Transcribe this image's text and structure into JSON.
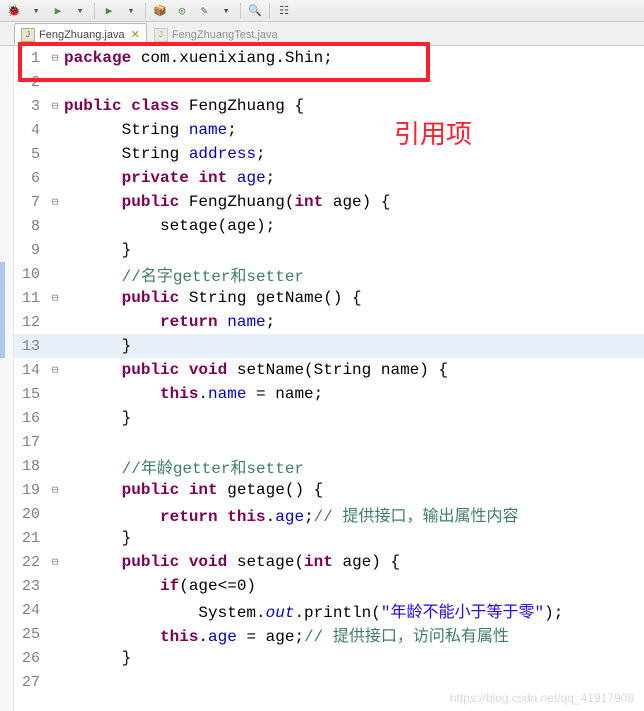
{
  "toolbar": {
    "icons": [
      "debug-icon",
      "dropdown-icon",
      "run-icon",
      "dropdown-icon",
      "sep",
      "run-ext-icon",
      "dropdown-icon",
      "sep",
      "pkg-icon",
      "doc-icon",
      "wand-icon",
      "dropdown-icon",
      "sep",
      "search-icon",
      "sep",
      "nav-icon"
    ]
  },
  "tabs": [
    {
      "label": "FengZhuang.java",
      "active": true
    },
    {
      "label": "FengZhuangTest.java",
      "active": false
    }
  ],
  "annotation": "引用项",
  "watermark": "https://blog.csdn.net/qq_41917908",
  "code_palette": {
    "keyword": "#7f0055",
    "field": "#0000c0",
    "comment": "#3f7f5f",
    "string": "#2a00ff"
  },
  "code": {
    "lines": [
      {
        "n": 1,
        "fold": "-",
        "hi": false,
        "tokens": [
          [
            "kw",
            "package"
          ],
          [
            "",
            " com.xuenixiang.Shin;"
          ]
        ]
      },
      {
        "n": 2,
        "fold": "",
        "hi": false,
        "tokens": []
      },
      {
        "n": 3,
        "fold": "-",
        "hi": false,
        "tokens": [
          [
            "kw",
            "public"
          ],
          [
            "",
            " "
          ],
          [
            "kw",
            "class"
          ],
          [
            "",
            " FengZhuang {"
          ]
        ]
      },
      {
        "n": 4,
        "fold": "",
        "hi": false,
        "tokens": [
          [
            "",
            "      String "
          ],
          [
            "fld",
            "name"
          ],
          [
            "",
            ";"
          ]
        ]
      },
      {
        "n": 5,
        "fold": "",
        "hi": false,
        "tokens": [
          [
            "",
            "      String "
          ],
          [
            "fld",
            "address"
          ],
          [
            "",
            ";"
          ]
        ]
      },
      {
        "n": 6,
        "fold": "",
        "hi": false,
        "tokens": [
          [
            "",
            "      "
          ],
          [
            "kw",
            "private"
          ],
          [
            "",
            " "
          ],
          [
            "kw",
            "int"
          ],
          [
            "",
            " "
          ],
          [
            "fld",
            "age"
          ],
          [
            "",
            ";"
          ]
        ]
      },
      {
        "n": 7,
        "fold": "-",
        "hi": false,
        "tokens": [
          [
            "",
            "      "
          ],
          [
            "kw",
            "public"
          ],
          [
            "",
            " FengZhuang("
          ],
          [
            "kw",
            "int"
          ],
          [
            "",
            " age) {"
          ]
        ]
      },
      {
        "n": 8,
        "fold": "",
        "hi": false,
        "tokens": [
          [
            "",
            "          setage(age);"
          ]
        ]
      },
      {
        "n": 9,
        "fold": "",
        "hi": false,
        "tokens": [
          [
            "",
            "      }"
          ]
        ]
      },
      {
        "n": 10,
        "fold": "",
        "hi": false,
        "tokens": [
          [
            "",
            "      "
          ],
          [
            "cm",
            "//名字getter和setter"
          ]
        ]
      },
      {
        "n": 11,
        "fold": "-",
        "hi": false,
        "tokens": [
          [
            "",
            "      "
          ],
          [
            "kw",
            "public"
          ],
          [
            "",
            " String getName() {"
          ]
        ]
      },
      {
        "n": 12,
        "fold": "",
        "hi": false,
        "tokens": [
          [
            "",
            "          "
          ],
          [
            "kw",
            "return"
          ],
          [
            "",
            " "
          ],
          [
            "fld",
            "name"
          ],
          [
            "",
            ";"
          ]
        ]
      },
      {
        "n": 13,
        "fold": "",
        "hi": true,
        "tokens": [
          [
            "",
            "      }"
          ]
        ]
      },
      {
        "n": 14,
        "fold": "-",
        "hi": false,
        "tokens": [
          [
            "",
            "      "
          ],
          [
            "kw",
            "public"
          ],
          [
            "",
            " "
          ],
          [
            "kw",
            "void"
          ],
          [
            "",
            " setName(String name) {"
          ]
        ]
      },
      {
        "n": 15,
        "fold": "",
        "hi": false,
        "tokens": [
          [
            "",
            "          "
          ],
          [
            "kw",
            "this"
          ],
          [
            "",
            "."
          ],
          [
            "fld",
            "name"
          ],
          [
            "",
            " = name;"
          ]
        ]
      },
      {
        "n": 16,
        "fold": "",
        "hi": false,
        "tokens": [
          [
            "",
            "      }"
          ]
        ]
      },
      {
        "n": 17,
        "fold": "",
        "hi": false,
        "tokens": []
      },
      {
        "n": 18,
        "fold": "",
        "hi": false,
        "tokens": [
          [
            "",
            "      "
          ],
          [
            "cm",
            "//年龄getter和setter"
          ]
        ]
      },
      {
        "n": 19,
        "fold": "-",
        "hi": false,
        "tokens": [
          [
            "",
            "      "
          ],
          [
            "kw",
            "public"
          ],
          [
            "",
            " "
          ],
          [
            "kw",
            "int"
          ],
          [
            "",
            " getage() {"
          ]
        ]
      },
      {
        "n": 20,
        "fold": "",
        "hi": false,
        "tokens": [
          [
            "",
            "          "
          ],
          [
            "kw",
            "return"
          ],
          [
            "",
            " "
          ],
          [
            "kw",
            "this"
          ],
          [
            "",
            "."
          ],
          [
            "fld",
            "age"
          ],
          [
            "",
            ";"
          ],
          [
            "cm",
            "// 提供接口，输出属性内容"
          ]
        ]
      },
      {
        "n": 21,
        "fold": "",
        "hi": false,
        "tokens": [
          [
            "",
            "      }"
          ]
        ]
      },
      {
        "n": 22,
        "fold": "-",
        "hi": false,
        "tokens": [
          [
            "",
            "      "
          ],
          [
            "kw",
            "public"
          ],
          [
            "",
            " "
          ],
          [
            "kw",
            "void"
          ],
          [
            "",
            " setage("
          ],
          [
            "kw",
            "int"
          ],
          [
            "",
            " age) {"
          ]
        ]
      },
      {
        "n": 23,
        "fold": "",
        "hi": false,
        "tokens": [
          [
            "",
            "          "
          ],
          [
            "kw",
            "if"
          ],
          [
            "",
            "(age<=0)"
          ]
        ]
      },
      {
        "n": 24,
        "fold": "",
        "hi": false,
        "tokens": [
          [
            "",
            "              System."
          ],
          [
            "stat",
            "out"
          ],
          [
            "",
            ".println("
          ],
          [
            "str",
            "\"年龄不能小于等于零\""
          ],
          [
            "",
            ");"
          ]
        ]
      },
      {
        "n": 25,
        "fold": "",
        "hi": false,
        "tokens": [
          [
            "",
            "          "
          ],
          [
            "kw",
            "this"
          ],
          [
            "",
            "."
          ],
          [
            "fld",
            "age"
          ],
          [
            "",
            " = age;"
          ],
          [
            "cm",
            "// 提供接口，访问私有属性"
          ]
        ]
      },
      {
        "n": 26,
        "fold": "",
        "hi": false,
        "tokens": [
          [
            "",
            "      }"
          ]
        ]
      },
      {
        "n": 27,
        "fold": "",
        "hi": false,
        "tokens": []
      }
    ]
  },
  "chart_data": null
}
